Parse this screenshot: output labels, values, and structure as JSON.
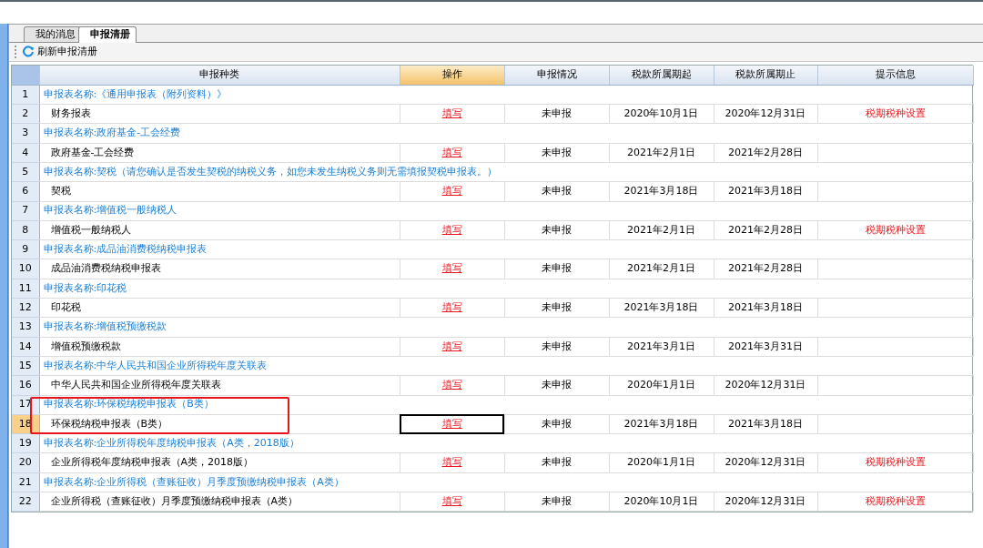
{
  "tabs": [
    {
      "label": "我的消息",
      "selected": false
    },
    {
      "label": "申报清册",
      "selected": true
    }
  ],
  "toolbar": {
    "refresh_button": "刷新申报清册"
  },
  "table": {
    "columns": [
      {
        "label": "申报种类",
        "selected": false
      },
      {
        "label": "操作",
        "selected": true
      },
      {
        "label": "申报情况",
        "selected": false
      },
      {
        "label": "税款所属期起",
        "selected": false
      },
      {
        "label": "税款所属期止",
        "selected": false
      },
      {
        "label": "提示信息",
        "selected": false
      }
    ],
    "rows": [
      {
        "kind": "group",
        "number": "1",
        "name": "申报表名称:《通用申报表（附列资料）》",
        "selected": false,
        "highlighted": false
      },
      {
        "kind": "item",
        "number": "2",
        "name": "财务报表",
        "action": "填写",
        "status": "未申报",
        "start": "2020年10月1日",
        "end": "2020年12月31日",
        "hint": "税期税种设置",
        "selected": false,
        "highlighted": false
      },
      {
        "kind": "group",
        "number": "3",
        "name": "申报表名称:政府基金-工会经费",
        "selected": false,
        "highlighted": false
      },
      {
        "kind": "item",
        "number": "4",
        "name": "政府基金-工会经费",
        "action": "填写",
        "status": "未申报",
        "start": "2021年2月1日",
        "end": "2021年2月28日",
        "selected": false,
        "highlighted": false
      },
      {
        "kind": "group",
        "number": "5",
        "name": "申报表名称:契税（请您确认是否发生契税的纳税义务，如您未发生纳税义务则无需填报契税申报表。）",
        "selected": false,
        "highlighted": false
      },
      {
        "kind": "item",
        "number": "6",
        "name": "契税",
        "action": "填写",
        "status": "未申报",
        "start": "2021年3月18日",
        "end": "2021年3月18日",
        "selected": false,
        "highlighted": false
      },
      {
        "kind": "group",
        "number": "7",
        "name": "申报表名称:增值税一般纳税人",
        "selected": false,
        "highlighted": false
      },
      {
        "kind": "item",
        "number": "8",
        "name": "增值税一般纳税人",
        "action": "填写",
        "status": "未申报",
        "start": "2021年2月1日",
        "end": "2021年2月28日",
        "hint": "税期税种设置",
        "selected": false,
        "highlighted": false
      },
      {
        "kind": "group",
        "number": "9",
        "name": "申报表名称:成品油消费税纳税申报表",
        "selected": false,
        "highlighted": false
      },
      {
        "kind": "item",
        "number": "10",
        "name": "成品油消费税纳税申报表",
        "action": "填写",
        "status": "未申报",
        "start": "2021年2月1日",
        "end": "2021年2月28日",
        "selected": false,
        "highlighted": false
      },
      {
        "kind": "group",
        "number": "11",
        "name": "申报表名称:印花税",
        "selected": false,
        "highlighted": false
      },
      {
        "kind": "item",
        "number": "12",
        "name": "印花税",
        "action": "填写",
        "status": "未申报",
        "start": "2021年3月18日",
        "end": "2021年3月18日",
        "selected": false,
        "highlighted": false
      },
      {
        "kind": "group",
        "number": "13",
        "name": "申报表名称:增值税预缴税款",
        "selected": false,
        "highlighted": false
      },
      {
        "kind": "item",
        "number": "14",
        "name": "增值税预缴税款",
        "action": "填写",
        "status": "未申报",
        "start": "2021年3月1日",
        "end": "2021年3月31日",
        "selected": false,
        "highlighted": false
      },
      {
        "kind": "group",
        "number": "15",
        "name": "申报表名称:中华人民共和国企业所得税年度关联表",
        "selected": false,
        "highlighted": false
      },
      {
        "kind": "item",
        "number": "16",
        "name": "中华人民共和国企业所得税年度关联表",
        "action": "填写",
        "status": "未申报",
        "start": "2020年1月1日",
        "end": "2020年12月31日",
        "selected": false,
        "highlighted": false
      },
      {
        "kind": "group",
        "number": "17",
        "name": "申报表名称:环保税纳税申报表（B类）",
        "selected": false,
        "highlighted": true
      },
      {
        "kind": "item",
        "number": "18",
        "name": "环保税纳税申报表（B类）",
        "action": "填写",
        "status": "未申报",
        "start": "2021年3月18日",
        "end": "2021年3月18日",
        "selected": true,
        "highlighted": true
      },
      {
        "kind": "group",
        "number": "19",
        "name": "申报表名称:企业所得税年度纳税申报表（A类，2018版）",
        "selected": false,
        "highlighted": false
      },
      {
        "kind": "item",
        "number": "20",
        "name": "企业所得税年度纳税申报表（A类，2018版）",
        "action": "填写",
        "status": "未申报",
        "start": "2020年1月1日",
        "end": "2020年12月31日",
        "hint": "税期税种设置",
        "selected": false,
        "highlighted": false
      },
      {
        "kind": "group",
        "number": "21",
        "name": "申报表名称:企业所得税（查账征收）月季度预缴纳税申报表（A类）",
        "selected": false,
        "highlighted": false
      },
      {
        "kind": "item",
        "number": "22",
        "name": "企业所得税（查账征收）月季度预缴纳税申报表（A类）",
        "action": "填写",
        "status": "未申报",
        "start": "2020年10月1日",
        "end": "2020年12月31日",
        "hint": "税期税种设置",
        "selected": false,
        "highlighted": false
      }
    ]
  }
}
